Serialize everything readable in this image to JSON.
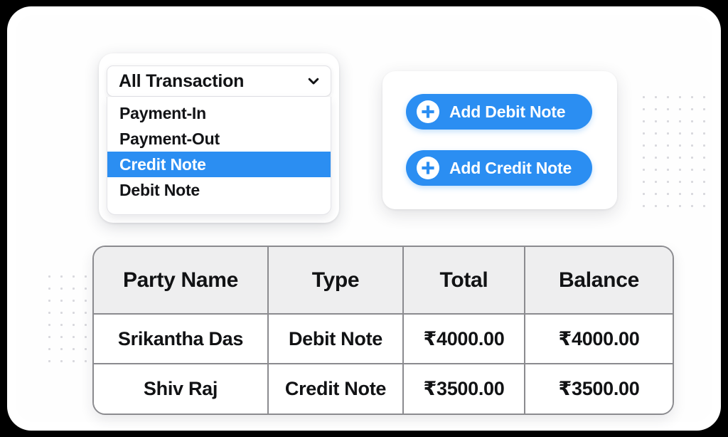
{
  "dropdown": {
    "selected_label": "All Transaction",
    "chevron_icon": "chevron-down-icon",
    "options": [
      {
        "label": "Payment-In",
        "selected": false
      },
      {
        "label": "Payment-Out",
        "selected": false
      },
      {
        "label": "Credit Note",
        "selected": true
      },
      {
        "label": "Debit Note",
        "selected": false
      }
    ]
  },
  "actions": {
    "plus_icon": "plus-circle-icon",
    "buttons": [
      {
        "label": "Add Debit Note",
        "name": "add-debit-note-button"
      },
      {
        "label": "Add Credit Note",
        "name": "add-credit-note-button"
      }
    ]
  },
  "table": {
    "columns": [
      "Party Name",
      "Type",
      "Total",
      "Balance"
    ],
    "rows": [
      {
        "party_name": "Srikantha Das",
        "type": "Debit Note",
        "total": "₹4000.00",
        "balance": "₹4000.00"
      },
      {
        "party_name": "Shiv Raj",
        "type": "Credit Note",
        "total": "₹3500.00",
        "balance": "₹3500.00"
      }
    ]
  },
  "colors": {
    "accent_blue": "#2b8ef2",
    "selected_row_blue": "#2b8ef2",
    "table_header_gray": "#eeeeef",
    "table_border_gray": "#8b8b8f",
    "text_dark": "#111214",
    "frame_black": "#000000",
    "dot_gray": "#d8d8dd"
  },
  "decoration": {
    "dots_right": {
      "cols": 6,
      "rows": 10
    },
    "dots_left": {
      "cols": 5,
      "rows": 8
    }
  }
}
